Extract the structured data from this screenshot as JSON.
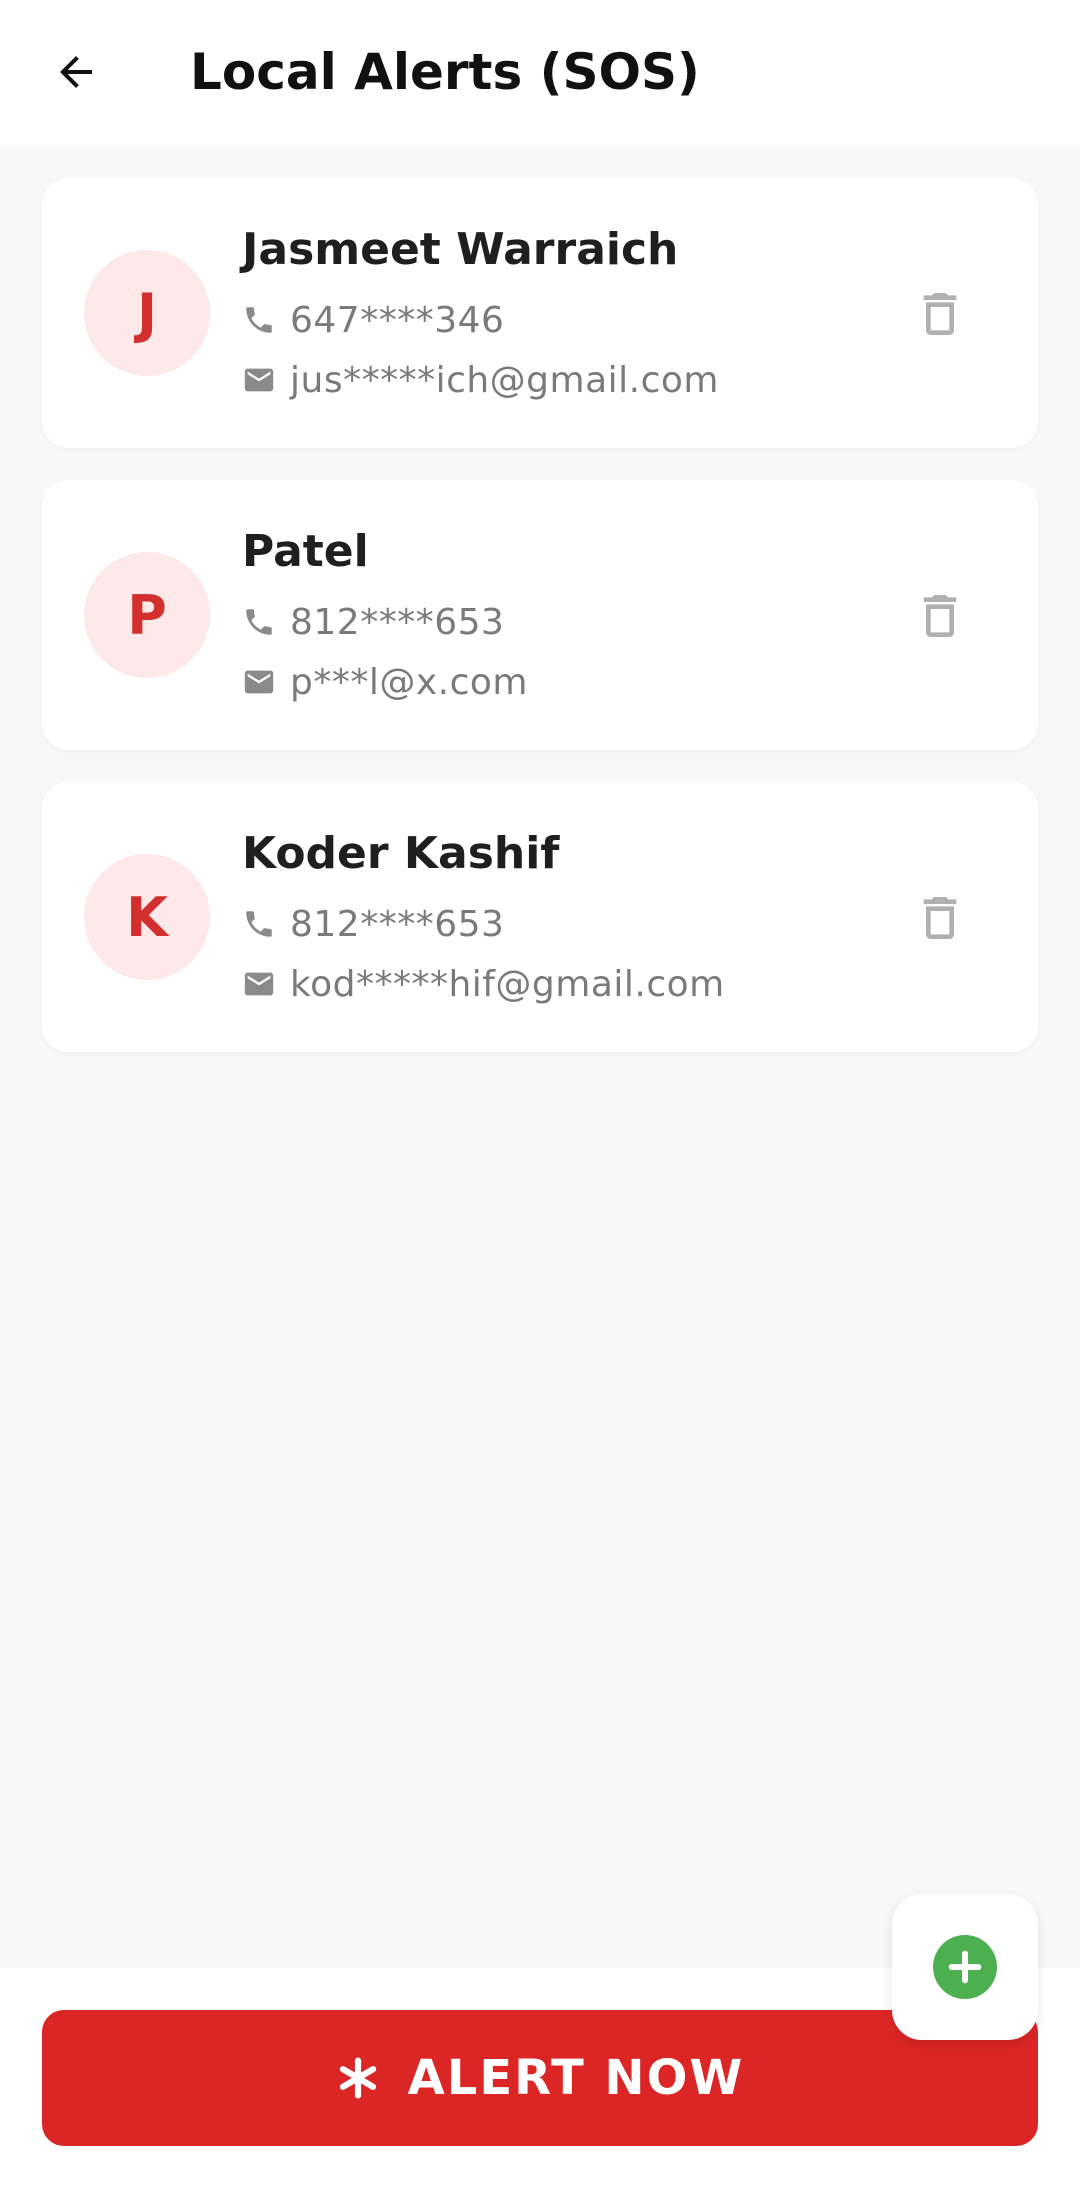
{
  "header": {
    "title": "Local Alerts (SOS)",
    "back_icon": "arrow-left-icon"
  },
  "contacts": [
    {
      "initial": "J",
      "name": "Jasmeet Warraich",
      "phone": "647****346",
      "email": "jus*****ich@gmail.com"
    },
    {
      "initial": "P",
      "name": "Patel",
      "phone": "812****653",
      "email": "p***l@x.com"
    },
    {
      "initial": "K",
      "name": "Koder Kashif",
      "phone": "812****653",
      "email": "kod*****hif@gmail.com"
    }
  ],
  "alert_button": {
    "label": "ALERT NOW",
    "icon": "asterisk-icon"
  },
  "fab": {
    "icon": "plus-circle-icon"
  },
  "colors": {
    "accent_red": "#dc2626",
    "avatar_bg": "#fde8ea",
    "avatar_text": "#d32f2f",
    "fab_green": "#4caf50",
    "background": "#f8f8f8"
  }
}
